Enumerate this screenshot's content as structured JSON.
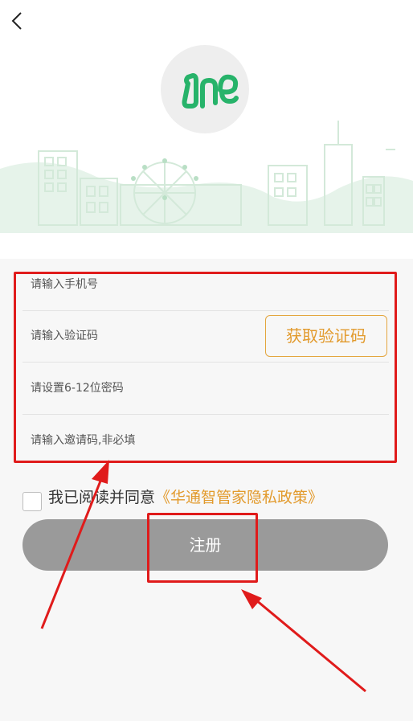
{
  "nav": {
    "back_icon": "chevron-left-icon"
  },
  "logo": {
    "text": "one",
    "color": "#27b36a"
  },
  "form": {
    "phone": {
      "placeholder": "请输入手机号"
    },
    "code": {
      "placeholder": "请输入验证码",
      "button_label": "获取验证码"
    },
    "password": {
      "placeholder": "请设置6-12位密码"
    },
    "invite": {
      "placeholder": "请输入邀请码,非必填"
    }
  },
  "agreement": {
    "text": "我已阅读并同意",
    "policy_link": "《华通智管家隐私政策》"
  },
  "register": {
    "label": "注册"
  },
  "colors": {
    "accent": "#e29a2c",
    "button_gray": "#9a9a9a",
    "annotation_red": "#e01b1b"
  }
}
